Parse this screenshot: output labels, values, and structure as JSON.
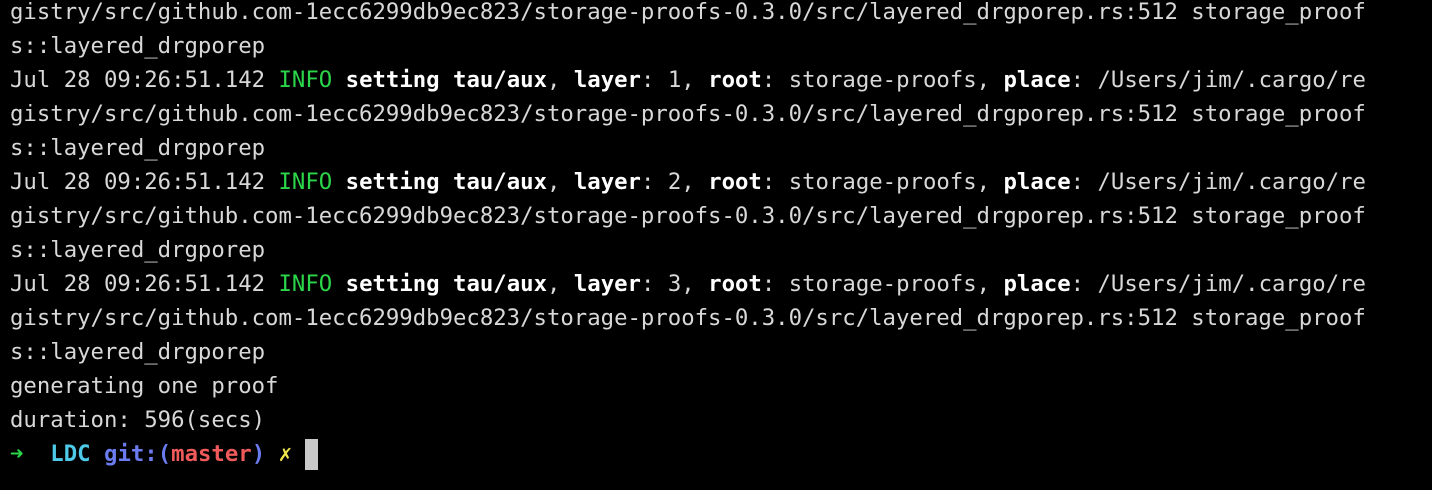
{
  "log": {
    "wrap_top_a": "gistry/src/github.com-1ecc6299db9ec823/storage-proofs-0.3.0/src/layered_drgporep.rs:512 storage_proof",
    "wrap_top_b": "s::layered_drgporep",
    "entries": [
      {
        "timestamp": "Jul 28 09:26:51.142",
        "level": "INFO",
        "message": "setting tau/aux",
        "layer_key": "layer",
        "layer_value": "1",
        "root_key": "root",
        "root_value": "storage-proofs",
        "place_key": "place",
        "place_value_a": "/Users/jim/.cargo/re",
        "place_value_b": "gistry/src/github.com-1ecc6299db9ec823/storage-proofs-0.3.0/src/layered_drgporep.rs:512 storage_proof",
        "place_value_c": "s::layered_drgporep"
      },
      {
        "timestamp": "Jul 28 09:26:51.142",
        "level": "INFO",
        "message": "setting tau/aux",
        "layer_key": "layer",
        "layer_value": "2",
        "root_key": "root",
        "root_value": "storage-proofs",
        "place_key": "place",
        "place_value_a": "/Users/jim/.cargo/re",
        "place_value_b": "gistry/src/github.com-1ecc6299db9ec823/storage-proofs-0.3.0/src/layered_drgporep.rs:512 storage_proof",
        "place_value_c": "s::layered_drgporep"
      },
      {
        "timestamp": "Jul 28 09:26:51.142",
        "level": "INFO",
        "message": "setting tau/aux",
        "layer_key": "layer",
        "layer_value": "3",
        "root_key": "root",
        "root_value": "storage-proofs",
        "place_key": "place",
        "place_value_a": "/Users/jim/.cargo/re",
        "place_value_b": "gistry/src/github.com-1ecc6299db9ec823/storage-proofs-0.3.0/src/layered_drgporep.rs:512 storage_proof",
        "place_value_c": "s::layered_drgporep"
      }
    ],
    "generating": "generating one proof",
    "duration": "duration: 596(secs)"
  },
  "prompt": {
    "arrow": "➜",
    "directory": "LDC",
    "git_prefix": "git:(",
    "branch": "master",
    "git_suffix": ")",
    "dirty_marker": "✗"
  },
  "colors": {
    "background": "#000000",
    "text": "#d8d8d8",
    "info": "#2bd64a",
    "arrow": "#2bd64a",
    "directory": "#4ec9e8",
    "git": "#6b7cf0",
    "branch": "#f05a5a",
    "dirty": "#f0e64a",
    "cursor": "#c9c9c9"
  }
}
